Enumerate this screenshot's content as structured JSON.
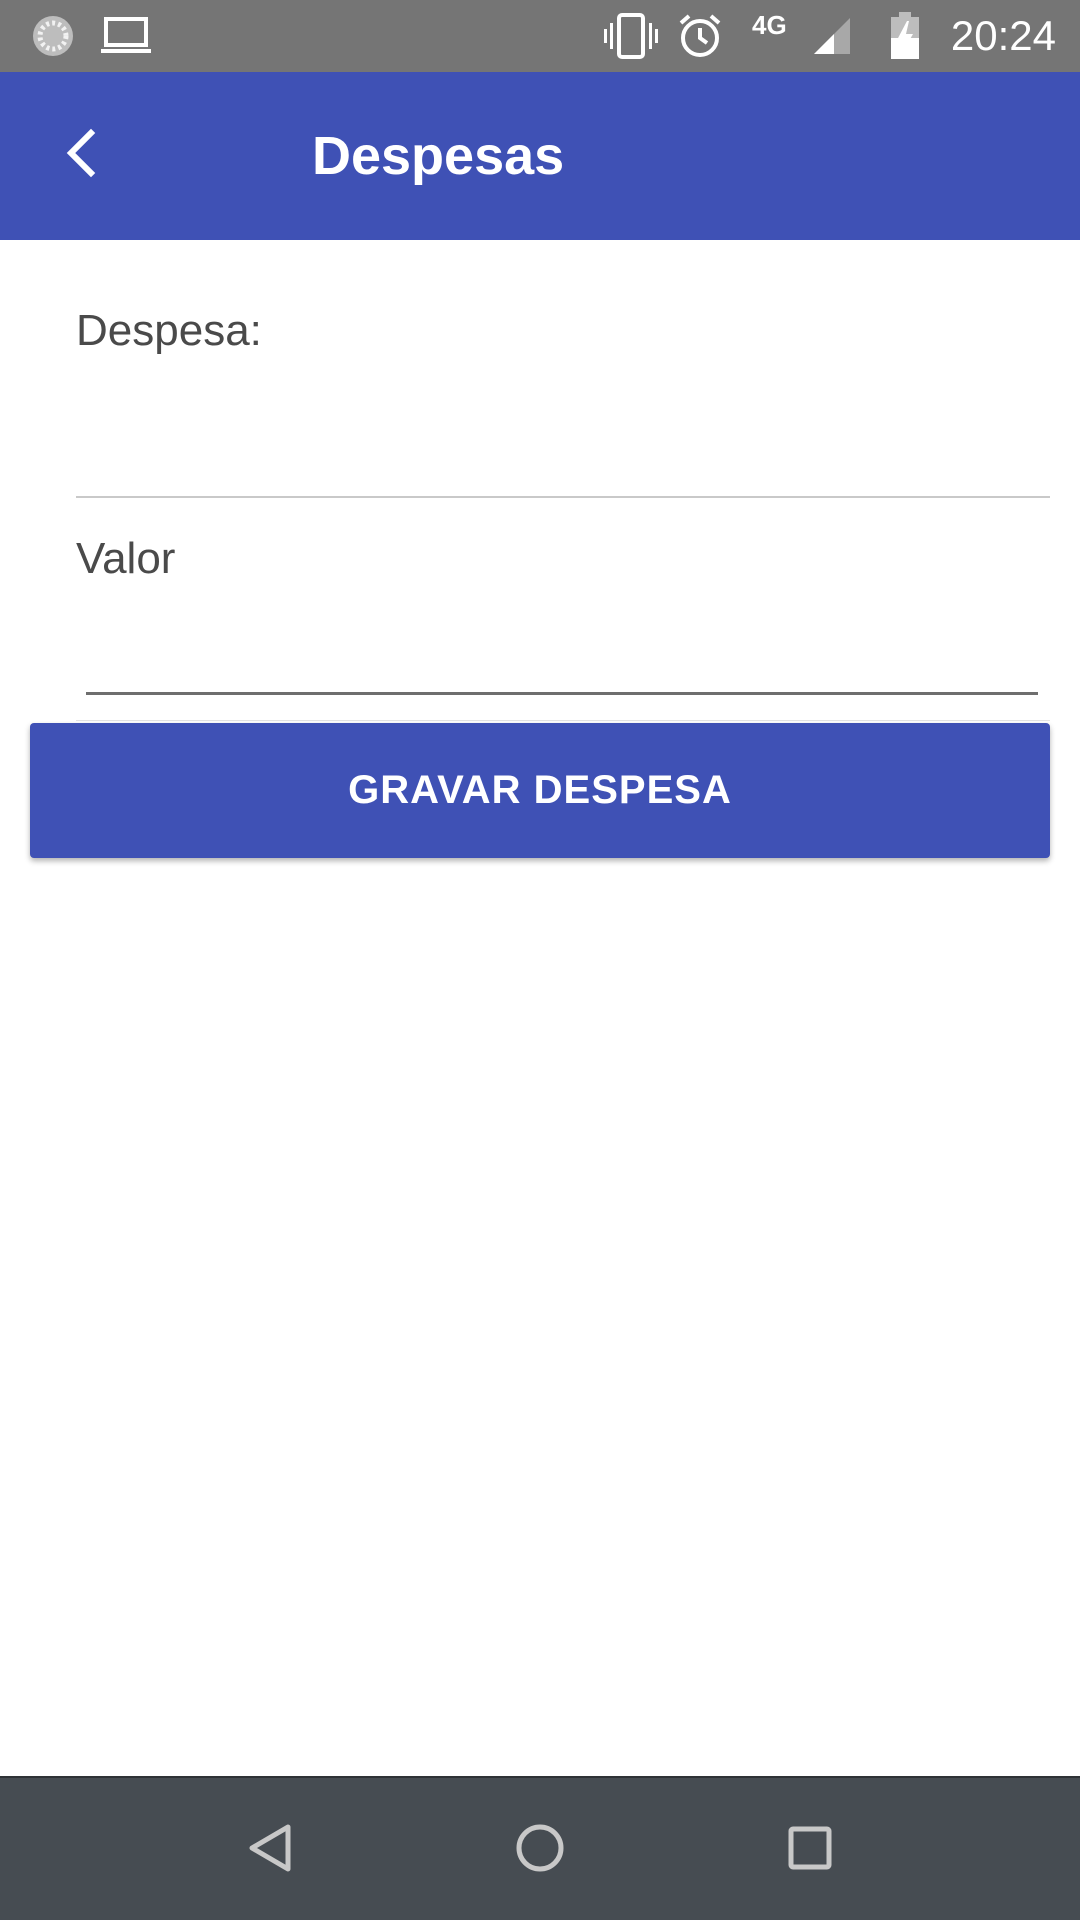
{
  "status_bar": {
    "time": "20:24",
    "network": "4G",
    "icons": [
      "sync-icon",
      "laptop-icon",
      "vibrate-icon",
      "alarm-icon",
      "signal-icon",
      "battery-charging-icon"
    ]
  },
  "app_bar": {
    "title": "Despesas",
    "back_icon": "chevron-left-icon"
  },
  "form": {
    "despesa_label": "Despesa:",
    "despesa_value": "",
    "valor_label": "Valor",
    "valor_value": "",
    "save_label": "GRAVAR DESPESA"
  },
  "nav_bar": {
    "icons": [
      "back-triangle-icon",
      "home-circle-icon",
      "recents-square-icon"
    ]
  },
  "colors": {
    "primary": "#3f51b5",
    "status_bar": "#757575",
    "nav_bar": "#464c52",
    "label_text": "#4a4a4a"
  }
}
